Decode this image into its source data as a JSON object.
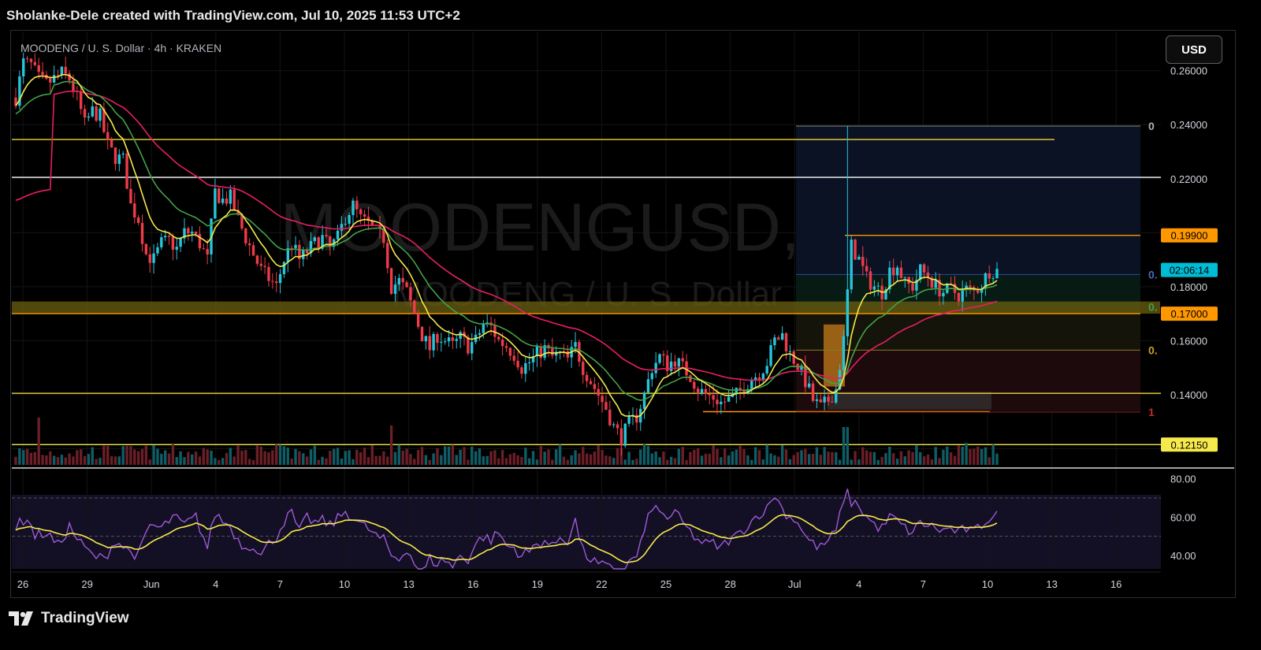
{
  "header": {
    "attribution": "Sholanke-Dele created with TradingView.com, Jul 10, 2025 11:53 UTC+2"
  },
  "toolbar": {
    "currency_label": "USD"
  },
  "footer": {
    "brand": "TradingView"
  },
  "chart_data": {
    "type": "candlestick",
    "symbol_line": "MOODENG / U. S. Dollar · 4h · KRAKEN",
    "watermark_symbol": "MOODENGUSD, 4h",
    "watermark_name": "MOODENG / U. S. Dollar",
    "x_tick_labels": [
      "26",
      "29",
      "Jun",
      "4",
      "7",
      "10",
      "13",
      "16",
      "19",
      "22",
      "25",
      "28",
      "Jul",
      "4",
      "7",
      "10",
      "13",
      "16"
    ],
    "y_tick_labels": [
      "0.26000",
      "0.24000",
      "0.22000",
      "0.18000",
      "0.16000",
      "0.14000"
    ],
    "ylim": [
      0.114,
      0.2745
    ],
    "price_badges": [
      {
        "label": "0.19900",
        "value": 0.199,
        "color": "#ff9800",
        "text_color": "#000000"
      },
      {
        "label": "02:06:14",
        "value": 0.1862,
        "color": "#00bcd4",
        "text_color": "#000000"
      },
      {
        "label": "0.17000",
        "value": 0.17,
        "color": "#ff9800",
        "text_color": "#000000"
      },
      {
        "label": "0.12150",
        "value": 0.1215,
        "color": "#f5e94b",
        "text_color": "#000000"
      }
    ],
    "horizontal_levels": [
      {
        "value": 0.2345,
        "color": "#f0d43a"
      },
      {
        "value": 0.2205,
        "color": "#ffffff"
      },
      {
        "value": 0.199,
        "color": "#ff9800"
      },
      {
        "value": 0.17,
        "color": "#ff9800"
      },
      {
        "value": 0.1405,
        "color": "#f0d43a"
      },
      {
        "value": 0.1337,
        "color": "#ff9800"
      },
      {
        "value": 0.1215,
        "color": "#f5e94b"
      }
    ],
    "support_zone": [
      0.17,
      0.1745
    ],
    "fib_labels": [
      {
        "label": "0",
        "value": 0.2395,
        "color": "#b0b0b0"
      },
      {
        "label": "0.",
        "value": 0.1845,
        "color": "#4a69bd"
      },
      {
        "label": "0.",
        "value": 0.1725,
        "color": "#43a047"
      },
      {
        "label": "0.",
        "value": 0.1565,
        "color": "#c9a227"
      },
      {
        "label": "1",
        "value": 0.1335,
        "color": "#c62828"
      }
    ],
    "price_path": [
      [
        0,
        0.25
      ],
      [
        2,
        0.263
      ],
      [
        4,
        0.262
      ],
      [
        6,
        0.257
      ],
      [
        8,
        0.255
      ],
      [
        10,
        0.257
      ],
      [
        12,
        0.259
      ],
      [
        14,
        0.257
      ],
      [
        16,
        0.25
      ],
      [
        18,
        0.24
      ],
      [
        20,
        0.245
      ],
      [
        22,
        0.243
      ],
      [
        24,
        0.232
      ],
      [
        26,
        0.228
      ],
      [
        28,
        0.227
      ],
      [
        30,
        0.21
      ],
      [
        32,
        0.205
      ],
      [
        34,
        0.192
      ],
      [
        36,
        0.19
      ],
      [
        38,
        0.196
      ],
      [
        40,
        0.197
      ],
      [
        42,
        0.194
      ],
      [
        44,
        0.2
      ],
      [
        46,
        0.2
      ],
      [
        48,
        0.196
      ],
      [
        50,
        0.19
      ],
      [
        52,
        0.215
      ],
      [
        54,
        0.212
      ],
      [
        56,
        0.213
      ],
      [
        58,
        0.205
      ],
      [
        60,
        0.198
      ],
      [
        62,
        0.192
      ],
      [
        64,
        0.186
      ],
      [
        66,
        0.183
      ],
      [
        68,
        0.18
      ],
      [
        70,
        0.19
      ],
      [
        72,
        0.196
      ],
      [
        74,
        0.19
      ],
      [
        76,
        0.193
      ],
      [
        78,
        0.196
      ],
      [
        80,
        0.198
      ],
      [
        82,
        0.194
      ],
      [
        84,
        0.198
      ],
      [
        86,
        0.206
      ],
      [
        88,
        0.21
      ],
      [
        90,
        0.205
      ],
      [
        92,
        0.203
      ],
      [
        94,
        0.2
      ],
      [
        96,
        0.198
      ],
      [
        98,
        0.18
      ],
      [
        100,
        0.182
      ],
      [
        102,
        0.178
      ],
      [
        104,
        0.17
      ],
      [
        106,
        0.162
      ],
      [
        108,
        0.157
      ],
      [
        110,
        0.162
      ],
      [
        112,
        0.16
      ],
      [
        114,
        0.158
      ],
      [
        116,
        0.161
      ],
      [
        118,
        0.158
      ],
      [
        120,
        0.16
      ],
      [
        122,
        0.166
      ],
      [
        124,
        0.165
      ],
      [
        126,
        0.16
      ],
      [
        128,
        0.158
      ],
      [
        130,
        0.155
      ],
      [
        132,
        0.15
      ],
      [
        134,
        0.152
      ],
      [
        136,
        0.155
      ],
      [
        138,
        0.157
      ],
      [
        140,
        0.154
      ],
      [
        142,
        0.155
      ],
      [
        144,
        0.153
      ],
      [
        146,
        0.158
      ],
      [
        148,
        0.15
      ],
      [
        150,
        0.145
      ],
      [
        152,
        0.14
      ],
      [
        154,
        0.135
      ],
      [
        156,
        0.128
      ],
      [
        158,
        0.124
      ],
      [
        160,
        0.129
      ],
      [
        162,
        0.132
      ],
      [
        164,
        0.14
      ],
      [
        166,
        0.15
      ],
      [
        168,
        0.154
      ],
      [
        170,
        0.151
      ],
      [
        172,
        0.153
      ],
      [
        174,
        0.15
      ],
      [
        176,
        0.147
      ],
      [
        178,
        0.142
      ],
      [
        180,
        0.14
      ],
      [
        182,
        0.139
      ],
      [
        184,
        0.137
      ],
      [
        186,
        0.138
      ],
      [
        188,
        0.14
      ],
      [
        190,
        0.143
      ],
      [
        192,
        0.146
      ],
      [
        194,
        0.148
      ],
      [
        196,
        0.152
      ],
      [
        198,
        0.16
      ],
      [
        200,
        0.162
      ],
      [
        202,
        0.155
      ],
      [
        204,
        0.151
      ],
      [
        206,
        0.145
      ],
      [
        208,
        0.138
      ],
      [
        210,
        0.135
      ],
      [
        212,
        0.138
      ],
      [
        214,
        0.142
      ],
      [
        216,
        0.16
      ],
      [
        217,
        0.178
      ],
      [
        218,
        0.195
      ],
      [
        220,
        0.19
      ],
      [
        222,
        0.183
      ],
      [
        224,
        0.18
      ],
      [
        226,
        0.178
      ],
      [
        228,
        0.186
      ],
      [
        230,
        0.188
      ],
      [
        232,
        0.181
      ],
      [
        234,
        0.18
      ],
      [
        236,
        0.186
      ],
      [
        238,
        0.184
      ],
      [
        240,
        0.18
      ],
      [
        242,
        0.178
      ],
      [
        244,
        0.179
      ],
      [
        246,
        0.177
      ],
      [
        248,
        0.179
      ],
      [
        250,
        0.178
      ],
      [
        252,
        0.181
      ],
      [
        254,
        0.186
      ],
      [
        256,
        0.186
      ]
    ],
    "rsi_ticks": [
      "80.00",
      "60.00",
      "40.00"
    ],
    "rsi_path": [
      [
        0,
        55
      ],
      [
        3,
        60
      ],
      [
        5,
        50
      ],
      [
        8,
        52
      ],
      [
        11,
        45
      ],
      [
        14,
        55
      ],
      [
        17,
        46
      ],
      [
        20,
        40
      ],
      [
        23,
        38
      ],
      [
        26,
        48
      ],
      [
        29,
        43
      ],
      [
        32,
        40
      ],
      [
        35,
        56
      ],
      [
        38,
        54
      ],
      [
        41,
        60
      ],
      [
        44,
        56
      ],
      [
        47,
        60
      ],
      [
        50,
        44
      ],
      [
        52,
        62
      ],
      [
        54,
        58
      ],
      [
        56,
        55
      ],
      [
        58,
        48
      ],
      [
        60,
        44
      ],
      [
        62,
        46
      ],
      [
        64,
        40
      ],
      [
        66,
        46
      ],
      [
        68,
        50
      ],
      [
        70,
        58
      ],
      [
        72,
        62
      ],
      [
        74,
        52
      ],
      [
        76,
        60
      ],
      [
        78,
        57
      ],
      [
        80,
        58
      ],
      [
        82,
        56
      ],
      [
        84,
        59
      ],
      [
        86,
        63
      ],
      [
        88,
        60
      ],
      [
        90,
        56
      ],
      [
        92,
        54
      ],
      [
        94,
        50
      ],
      [
        96,
        48
      ],
      [
        98,
        40
      ],
      [
        100,
        38
      ],
      [
        102,
        44
      ],
      [
        104,
        36
      ],
      [
        106,
        30
      ],
      [
        108,
        38
      ],
      [
        110,
        36
      ],
      [
        112,
        38
      ],
      [
        114,
        34
      ],
      [
        116,
        40
      ],
      [
        118,
        38
      ],
      [
        120,
        46
      ],
      [
        122,
        50
      ],
      [
        124,
        48
      ],
      [
        126,
        52
      ],
      [
        128,
        45
      ],
      [
        130,
        44
      ],
      [
        132,
        40
      ],
      [
        134,
        42
      ],
      [
        136,
        46
      ],
      [
        138,
        48
      ],
      [
        140,
        44
      ],
      [
        142,
        50
      ],
      [
        144,
        48
      ],
      [
        146,
        58
      ],
      [
        148,
        42
      ],
      [
        150,
        38
      ],
      [
        152,
        35
      ],
      [
        154,
        34
      ],
      [
        156,
        32
      ],
      [
        158,
        30
      ],
      [
        160,
        36
      ],
      [
        162,
        40
      ],
      [
        164,
        52
      ],
      [
        166,
        66
      ],
      [
        168,
        62
      ],
      [
        170,
        60
      ],
      [
        172,
        62
      ],
      [
        174,
        57
      ],
      [
        176,
        52
      ],
      [
        178,
        48
      ],
      [
        180,
        46
      ],
      [
        182,
        46
      ],
      [
        184,
        44
      ],
      [
        186,
        48
      ],
      [
        188,
        50
      ],
      [
        190,
        54
      ],
      [
        192,
        58
      ],
      [
        194,
        62
      ],
      [
        196,
        64
      ],
      [
        198,
        72
      ],
      [
        200,
        64
      ],
      [
        202,
        60
      ],
      [
        204,
        58
      ],
      [
        206,
        50
      ],
      [
        208,
        46
      ],
      [
        210,
        44
      ],
      [
        212,
        48
      ],
      [
        214,
        52
      ],
      [
        216,
        70
      ],
      [
        217,
        72
      ],
      [
        218,
        68
      ],
      [
        220,
        66
      ],
      [
        222,
        60
      ],
      [
        224,
        56
      ],
      [
        226,
        54
      ],
      [
        228,
        60
      ],
      [
        230,
        58
      ],
      [
        232,
        54
      ],
      [
        234,
        52
      ],
      [
        236,
        57
      ],
      [
        238,
        56
      ],
      [
        240,
        54
      ],
      [
        242,
        53
      ],
      [
        244,
        54
      ],
      [
        246,
        52
      ],
      [
        248,
        54
      ],
      [
        250,
        52
      ],
      [
        252,
        56
      ],
      [
        254,
        60
      ],
      [
        256,
        62
      ]
    ]
  }
}
